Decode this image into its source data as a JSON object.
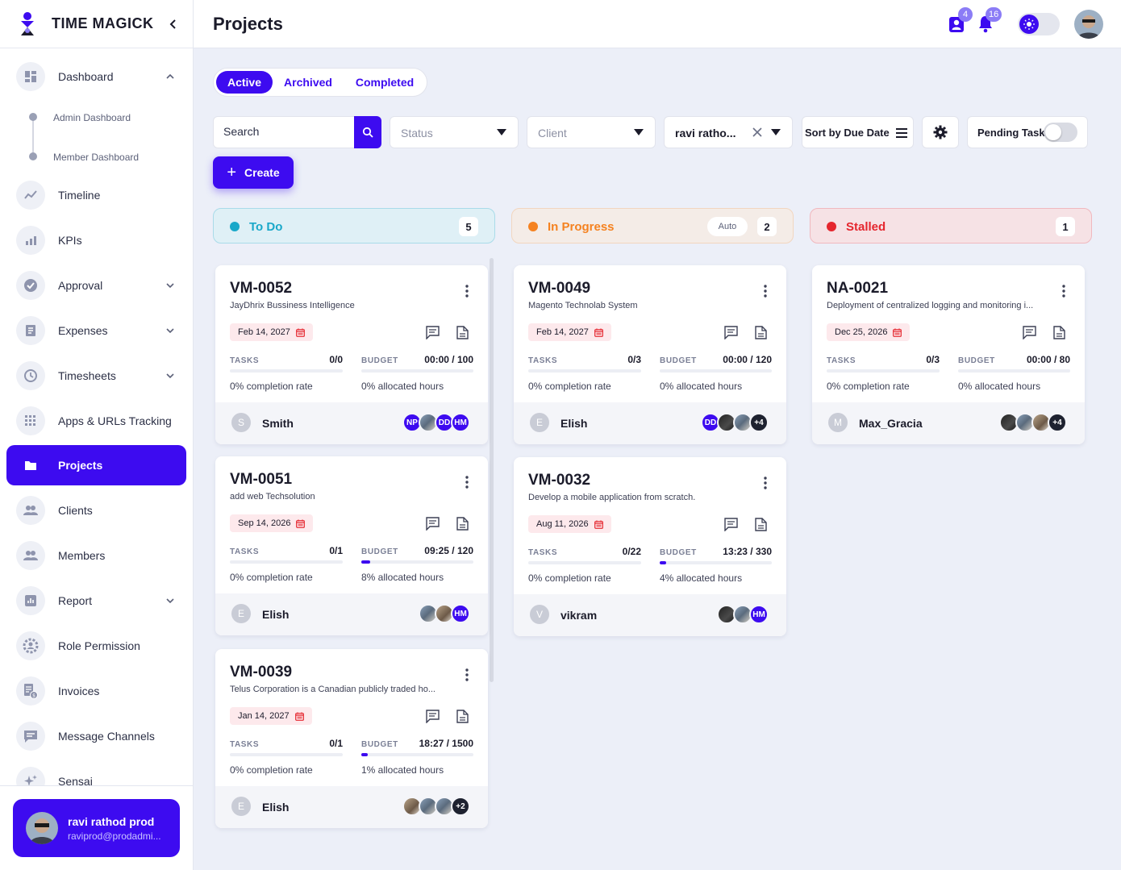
{
  "brand": {
    "name": "TIME MAGICK"
  },
  "sidebar": {
    "items": [
      {
        "label": "Dashboard",
        "icon": "dashboard-icon",
        "expanded": true
      },
      {
        "label": "Timeline",
        "icon": "timeline-icon"
      },
      {
        "label": "KPIs",
        "icon": "kpi-icon"
      },
      {
        "label": "Approval",
        "icon": "approval-icon"
      },
      {
        "label": "Expenses",
        "icon": "expenses-icon"
      },
      {
        "label": "Timesheets",
        "icon": "clock-icon"
      },
      {
        "label": "Apps & URLs Tracking",
        "icon": "apps-grid-icon"
      },
      {
        "label": "Projects",
        "icon": "folder-icon",
        "active": true
      },
      {
        "label": "Clients",
        "icon": "clients-icon"
      },
      {
        "label": "Members",
        "icon": "members-icon"
      },
      {
        "label": "Report",
        "icon": "report-icon"
      },
      {
        "label": "Role Permission",
        "icon": "role-permission-icon"
      },
      {
        "label": "Invoices",
        "icon": "invoice-icon"
      },
      {
        "label": "Message Channels",
        "icon": "message-icon"
      },
      {
        "label": "Sensai",
        "icon": "sparkle-icon"
      }
    ],
    "dashboard_sub": [
      "Admin Dashboard",
      "Member Dashboard"
    ],
    "user": {
      "name": "ravi rathod prod",
      "email": "raviprod@prodadmi..."
    }
  },
  "topbar": {
    "title": "Projects",
    "notifications": {
      "people_count": "4",
      "bell_count": "16"
    }
  },
  "tabs": [
    "Active",
    "Archived",
    "Completed"
  ],
  "filters": {
    "search_placeholder": "Search",
    "status_placeholder": "Status",
    "client_placeholder": "Client",
    "member_value": "ravi ratho...",
    "sort_label": "Sort by Due Date",
    "pending_label": "Pending Task"
  },
  "create_label": "Create",
  "columns": [
    {
      "title": "To Do",
      "count": "5",
      "color": "#1aa8c9"
    },
    {
      "title": "In Progress",
      "count": "2",
      "auto": "Auto",
      "color": "#f58220"
    },
    {
      "title": "Stalled",
      "count": "1",
      "color": "#e5262e"
    }
  ],
  "labels": {
    "tasks": "TASKS",
    "budget": "BUDGET"
  },
  "cards": [
    {
      "code": "VM-0052",
      "desc": "JayDhrix Bussiness Intelligence",
      "date": "Feb 14, 2027",
      "tasks": "0/0",
      "budget": "00:00 / 100",
      "completion": "0% completion rate",
      "allocated": "0% allocated hours",
      "task_fill": 0,
      "budget_fill": 0,
      "owner_initial": "S",
      "owner": "Smith",
      "members": [
        "NP",
        "photo",
        "DD",
        "HM"
      ]
    },
    {
      "code": "VM-0051",
      "desc": "add web Techsolution",
      "date": "Sep 14, 2026",
      "tasks": "0/1",
      "budget": "09:25 / 120",
      "completion": "0% completion rate",
      "allocated": "8% allocated hours",
      "task_fill": 0,
      "budget_fill": 0.08,
      "owner_initial": "E",
      "owner": "Elish",
      "members": [
        "photo",
        "photo3",
        "HM"
      ]
    },
    {
      "code": "VM-0039",
      "desc": "Telus Corporation is a Canadian publicly traded ho...",
      "date": "Jan 14, 2027",
      "tasks": "0/1",
      "budget": "18:27 / 1500",
      "completion": "0% completion rate",
      "allocated": "1% allocated hours",
      "task_fill": 0,
      "budget_fill": 0.01,
      "owner_initial": "E",
      "owner": "Elish",
      "members": [
        "photo3",
        "photo",
        "photo",
        "+2"
      ]
    },
    {
      "code": "VM-0049",
      "desc": "Magento Technolab System",
      "date": "Feb 14, 2027",
      "tasks": "0/3",
      "budget": "00:00 / 120",
      "completion": "0% completion rate",
      "allocated": "0% allocated hours",
      "task_fill": 0,
      "budget_fill": 0,
      "owner_initial": "E",
      "owner": "Elish",
      "members": [
        "DD",
        "photo2",
        "photo",
        "+4"
      ]
    },
    {
      "code": "VM-0032",
      "desc": "Develop a mobile application from scratch.",
      "date": "Aug 11, 2026",
      "tasks": "0/22",
      "budget": "13:23 / 330",
      "completion": "0% completion rate",
      "allocated": "4% allocated hours",
      "task_fill": 0,
      "budget_fill": 0.04,
      "owner_initial": "V",
      "owner": "vikram",
      "members": [
        "photo2",
        "photo",
        "HM"
      ]
    },
    {
      "code": "NA-0021",
      "desc": "Deployment of centralized logging and monitoring i...",
      "date": "Dec 25, 2026",
      "tasks": "0/3",
      "budget": "00:00 / 80",
      "completion": "0% completion rate",
      "allocated": "0% allocated hours",
      "task_fill": 0,
      "budget_fill": 0,
      "owner_initial": "M",
      "owner": "Max_Gracia",
      "members": [
        "photo2",
        "photo",
        "photo3",
        "+4"
      ]
    }
  ]
}
